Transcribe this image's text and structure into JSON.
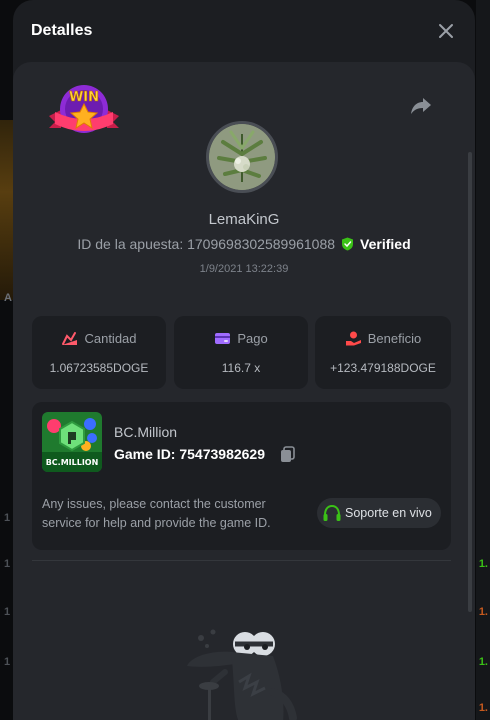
{
  "modal": {
    "title": "Detalles"
  },
  "player": {
    "username": "LemaKinG",
    "bet_id_label": "ID de la apuesta: 1709698302589961088",
    "verified_label": "Verified",
    "timestamp": "1/9/2021 13:22:39"
  },
  "badge": {
    "text": "WIN"
  },
  "stats": {
    "amount": {
      "label": "Cantidad",
      "value": "1.06723585DOGE"
    },
    "payout": {
      "label": "Pago",
      "value": "116.7 x"
    },
    "profit": {
      "label": "Beneficio",
      "value": "+123.479188DOGE"
    }
  },
  "game": {
    "name": "BC.Million",
    "logo_text": "BC.MILLION",
    "id_label": "Game ID:",
    "id_value": "7547398262 9",
    "id_full": "Game ID: 75473982629",
    "issues_text": "Any issues, please contact the customer service for help and provide the game ID.",
    "support_label": "Soporte en vivo"
  },
  "background": {
    "left_letter": "A",
    "left_rows": [
      "1",
      "1",
      "1",
      "1"
    ],
    "right_rows": [
      "1.",
      "1.",
      "1.",
      "1."
    ]
  },
  "colors": {
    "accent_green": "#3bc117",
    "amount_icon": "#ff5a6b",
    "payout_icon": "#a06cff",
    "profit_icon": "#ff4a4a",
    "modal_bg": "#1c1e22",
    "panel_bg": "#25272c"
  },
  "icons": {
    "close": "close-icon",
    "share": "share-icon",
    "verified": "shield-check-icon",
    "amount": "coins-icon",
    "payout": "wallet-icon",
    "profit": "profit-hand-icon",
    "copy": "copy-icon",
    "support": "headset-icon"
  }
}
